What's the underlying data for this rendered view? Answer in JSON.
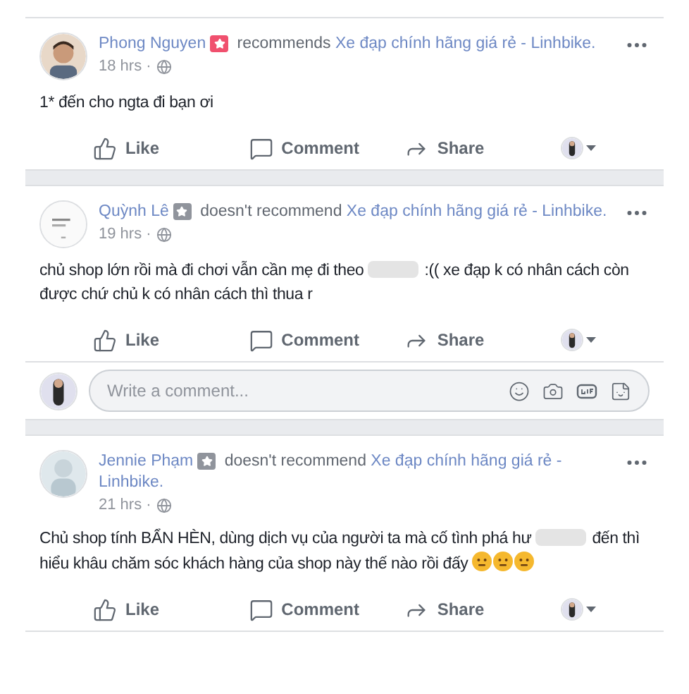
{
  "posts": [
    {
      "author": "Phong Nguyen",
      "kind": "recommend",
      "verb": "recommends",
      "page": "Xe đạp chính hãng giá rẻ - Linhbike.",
      "time": "18 hrs ·",
      "body": [
        {
          "kind": "text",
          "text": "1* đến cho ngta đi bạn ơi"
        }
      ],
      "actions": [
        "Like",
        "Comment",
        "Share"
      ]
    },
    {
      "author": "Quỳnh Lê",
      "kind": "not_recommend",
      "verb": "doesn't recommend",
      "page": "Xe đạp chính hãng giá rẻ - Linhbike.",
      "time": "19 hrs ·",
      "body": [
        {
          "kind": "text",
          "text": "chủ shop lớn rồi mà đi chơi vẫn cần mẹ đi theo"
        },
        {
          "kind": "censor"
        },
        {
          "kind": "text",
          "text": ":(( xe đạp k có nhân cách còn được chứ chủ k có nhân cách thì thua r"
        }
      ],
      "actions": [
        "Like",
        "Comment",
        "Share"
      ],
      "comment_box": {
        "placeholder": "Write a comment..."
      }
    },
    {
      "author": "Jennie Phạm",
      "kind": "not_recommend",
      "verb": "doesn't recommend",
      "page": "Xe đạp chính hãng giá rẻ - Linhbike.",
      "time": "21 hrs ·",
      "body": [
        {
          "kind": "text",
          "text": "Chủ shop tính BẨN HÈN, dùng dịch vụ của người ta mà cố tình phá hư"
        },
        {
          "kind": "censor"
        },
        {
          "kind": "text",
          "text": "đến thì hiểu khâu chăm sóc khách hàng của shop này thế nào rồi đấy"
        },
        {
          "kind": "emoji"
        },
        {
          "kind": "emoji"
        },
        {
          "kind": "emoji"
        }
      ],
      "actions": [
        "Like",
        "Comment",
        "Share"
      ]
    }
  ]
}
